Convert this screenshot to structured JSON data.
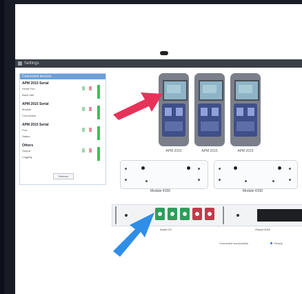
{
  "window": {
    "title": "Settings"
  },
  "side_panel": {
    "header": "Connected devices",
    "groups": [
      {
        "title": "APM 2015 Serial",
        "rows": [
          "Serial Port",
          "Baud rate"
        ]
      },
      {
        "title": "APM 2015 Serial",
        "rows": [
          "Module",
          "Connection"
        ]
      },
      {
        "title": "APM 2015 Serial",
        "rows": [
          "Port",
          "Status"
        ]
      }
    ],
    "extra_group": {
      "title": "Others",
      "rows": [
        "Output",
        "Logging"
      ]
    },
    "button": "Refresh"
  },
  "devices": [
    {
      "label": "APM 2015"
    },
    {
      "label": "APM 2015"
    },
    {
      "label": "APM 2015"
    }
  ],
  "modules": [
    {
      "label": "Module 4150"
    },
    {
      "label": "Module 4150"
    }
  ],
  "strip": {
    "label_left": "Audio I/O",
    "label_right": "Output 4002"
  },
  "status": {
    "left": "Connected successfully",
    "right": "Ready"
  },
  "colors": {
    "red_arrow": "#e8325a",
    "blue_arrow": "#2f8ee8",
    "titlebar": "#3a3f45",
    "panel_header": "#6d9fd9",
    "green": "#39c25a",
    "keypad": "#3f4f88"
  },
  "icons": [
    "arrow-pointing-right",
    "arrow-pointing-up-right"
  ]
}
